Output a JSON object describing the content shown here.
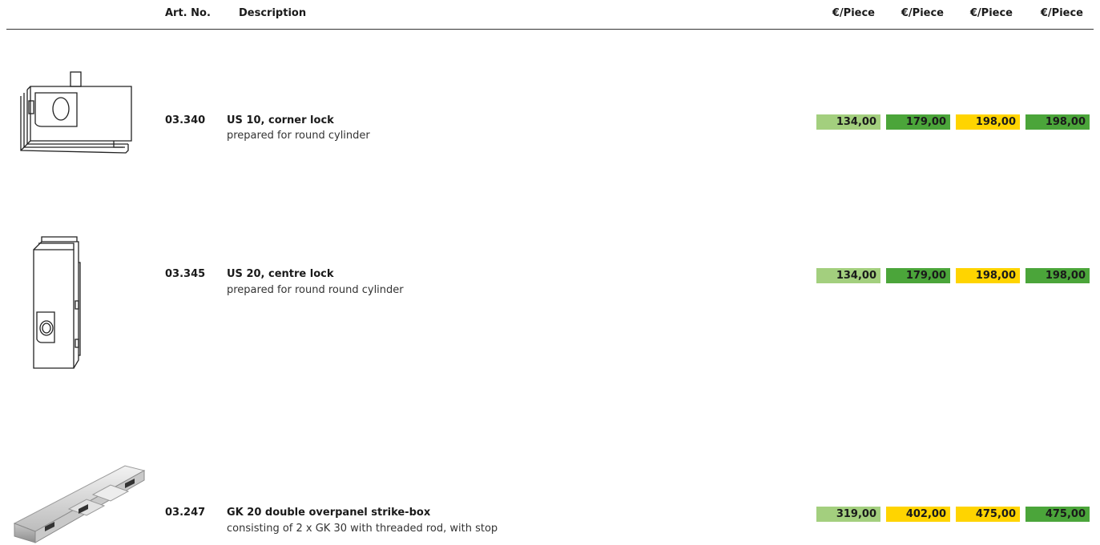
{
  "header": {
    "art_no": "Art. No.",
    "description": "Description",
    "price_cols": [
      "€/Piece",
      "€/Piece",
      "€/Piece",
      "€/Piece"
    ]
  },
  "colors": {
    "light_green": "#a3cf7e",
    "green": "#4ba53a",
    "yellow": "#ffd400"
  },
  "products": [
    {
      "art_no": "03.340",
      "title": "US 10, corner lock",
      "subtitle": "prepared for round cylinder",
      "prices": [
        "134,00",
        "179,00",
        "198,00",
        "198,00"
      ],
      "price_colors": [
        "light",
        "green",
        "yellow",
        "green"
      ],
      "icon": "corner-lock-icon"
    },
    {
      "art_no": "03.345",
      "title": "US 20, centre lock",
      "subtitle": "prepared for round round cylinder",
      "prices": [
        "134,00",
        "179,00",
        "198,00",
        "198,00"
      ],
      "price_colors": [
        "light",
        "green",
        "yellow",
        "green"
      ],
      "icon": "centre-lock-icon"
    },
    {
      "art_no": "03.247",
      "title": "GK 20 double overpanel strike-box",
      "subtitle": "consisting of 2 x GK 30 with threaded rod, with stop",
      "prices": [
        "319,00",
        "402,00",
        "475,00",
        "475,00"
      ],
      "price_colors": [
        "light",
        "yellow",
        "yellow",
        "green"
      ],
      "icon": "strike-box-icon"
    }
  ]
}
